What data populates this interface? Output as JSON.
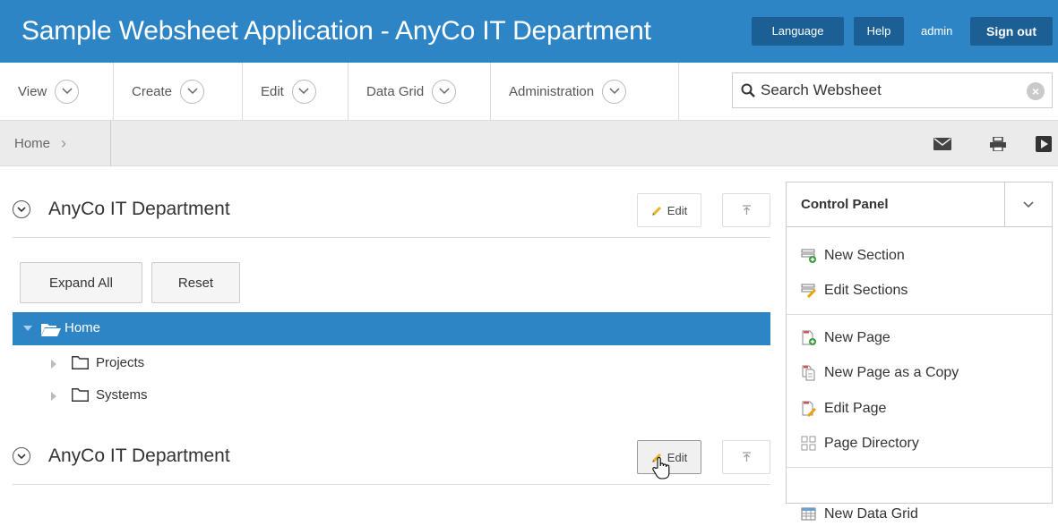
{
  "header": {
    "title": "Sample Websheet Application - AnyCo IT Department",
    "language": "Language",
    "help": "Help",
    "user": "admin",
    "signout": "Sign out"
  },
  "menu": {
    "items": [
      "View",
      "Create",
      "Edit",
      "Data Grid",
      "Administration"
    ]
  },
  "search": {
    "placeholder": "Search Websheet"
  },
  "breadcrumb": {
    "home": "Home"
  },
  "sections": [
    {
      "title": "AnyCo IT Department",
      "edit": "Edit"
    },
    {
      "title": "AnyCo IT Department",
      "edit": "Edit"
    }
  ],
  "tree": {
    "expand_all": "Expand All",
    "reset": "Reset",
    "root": "Home",
    "children": [
      "Projects",
      "Systems"
    ]
  },
  "control_panel": {
    "title": "Control Panel",
    "items": [
      "New Section",
      "Edit Sections",
      "New Page",
      "New Page as a Copy",
      "Edit Page",
      "Page Directory",
      "New Data Grid"
    ]
  },
  "colors": {
    "header_blue": "#2e85c6",
    "header_button": "#1c5f95",
    "selected_row": "#2e85c6"
  }
}
